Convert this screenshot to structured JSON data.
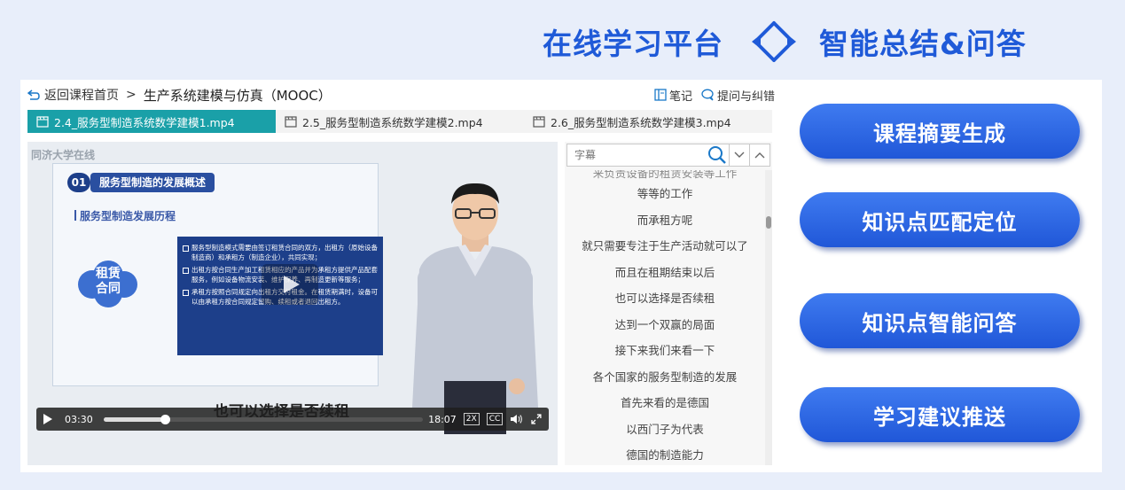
{
  "banner": {
    "left_title": "在线学习平台",
    "right_title": "智能总结&问答",
    "swap_icon": "double-arrow-swap-icon"
  },
  "header": {
    "back_label": "返回课程首页",
    "separator": ">",
    "course_title": "生产系统建模与仿真（MOOC）",
    "notes_label": "笔记",
    "ask_label": "提问与纠错"
  },
  "tabs": [
    {
      "label": "2.4_服务型制造系统数学建模1.mp4",
      "active": true
    },
    {
      "label": "2.5_服务型制造系统数学建模2.mp4",
      "active": false
    },
    {
      "label": "2.6_服务型制造系统数学建模3.mp4",
      "active": false
    }
  ],
  "video": {
    "watermark": "同济大学在线",
    "slide": {
      "number": "01",
      "title": "服务型制造的发展概述",
      "subtitle": "服务型制造发展历程",
      "cloud_text": "租赁合同",
      "bullets": [
        "服务型制造模式需要由签订租赁合同的双方，出租方（原始设备制造商）和承租方（制造企业），共同实现；",
        "出租方按合同生产加工租赁相应的产品并为承租方提供产品配套服务，例如设备物流安装、维护保养、再制造更新等服务；",
        "承租方按照合同规定向出租方交付租金。在租赁期满时，设备可以由承租方按合同规定留购、续租或者退回出租方。"
      ]
    },
    "subtitle_peek": "也可以选择是否续租",
    "controls": {
      "current_time": "03:30",
      "duration": "18:07",
      "progress_fraction": 0.193,
      "speed_label": "2X",
      "cc_label": "CC"
    }
  },
  "subtitles": {
    "search_placeholder": "字幕",
    "partial_top": "来负责设备的租赁安装等工作",
    "lines": [
      "等等的工作",
      "而承租方呢",
      "就只需要专注于生产活动就可以了",
      "而且在租期结束以后",
      "也可以选择是否续租",
      "达到一个双赢的局面",
      "接下来我们来看一下",
      "各个国家的服务型制造的发展",
      "首先来看的是德国",
      "以西门子为代表",
      "德国的制造能力"
    ]
  },
  "features": [
    {
      "label": "课程摘要生成"
    },
    {
      "label": "知识点匹配定位"
    },
    {
      "label": "知识点智能问答"
    },
    {
      "label": "学习建议推送"
    }
  ],
  "colors": {
    "banner_blue": "#1f5ad8",
    "tab_active": "#1aa0a8",
    "feature_button": "#2a63e0"
  }
}
